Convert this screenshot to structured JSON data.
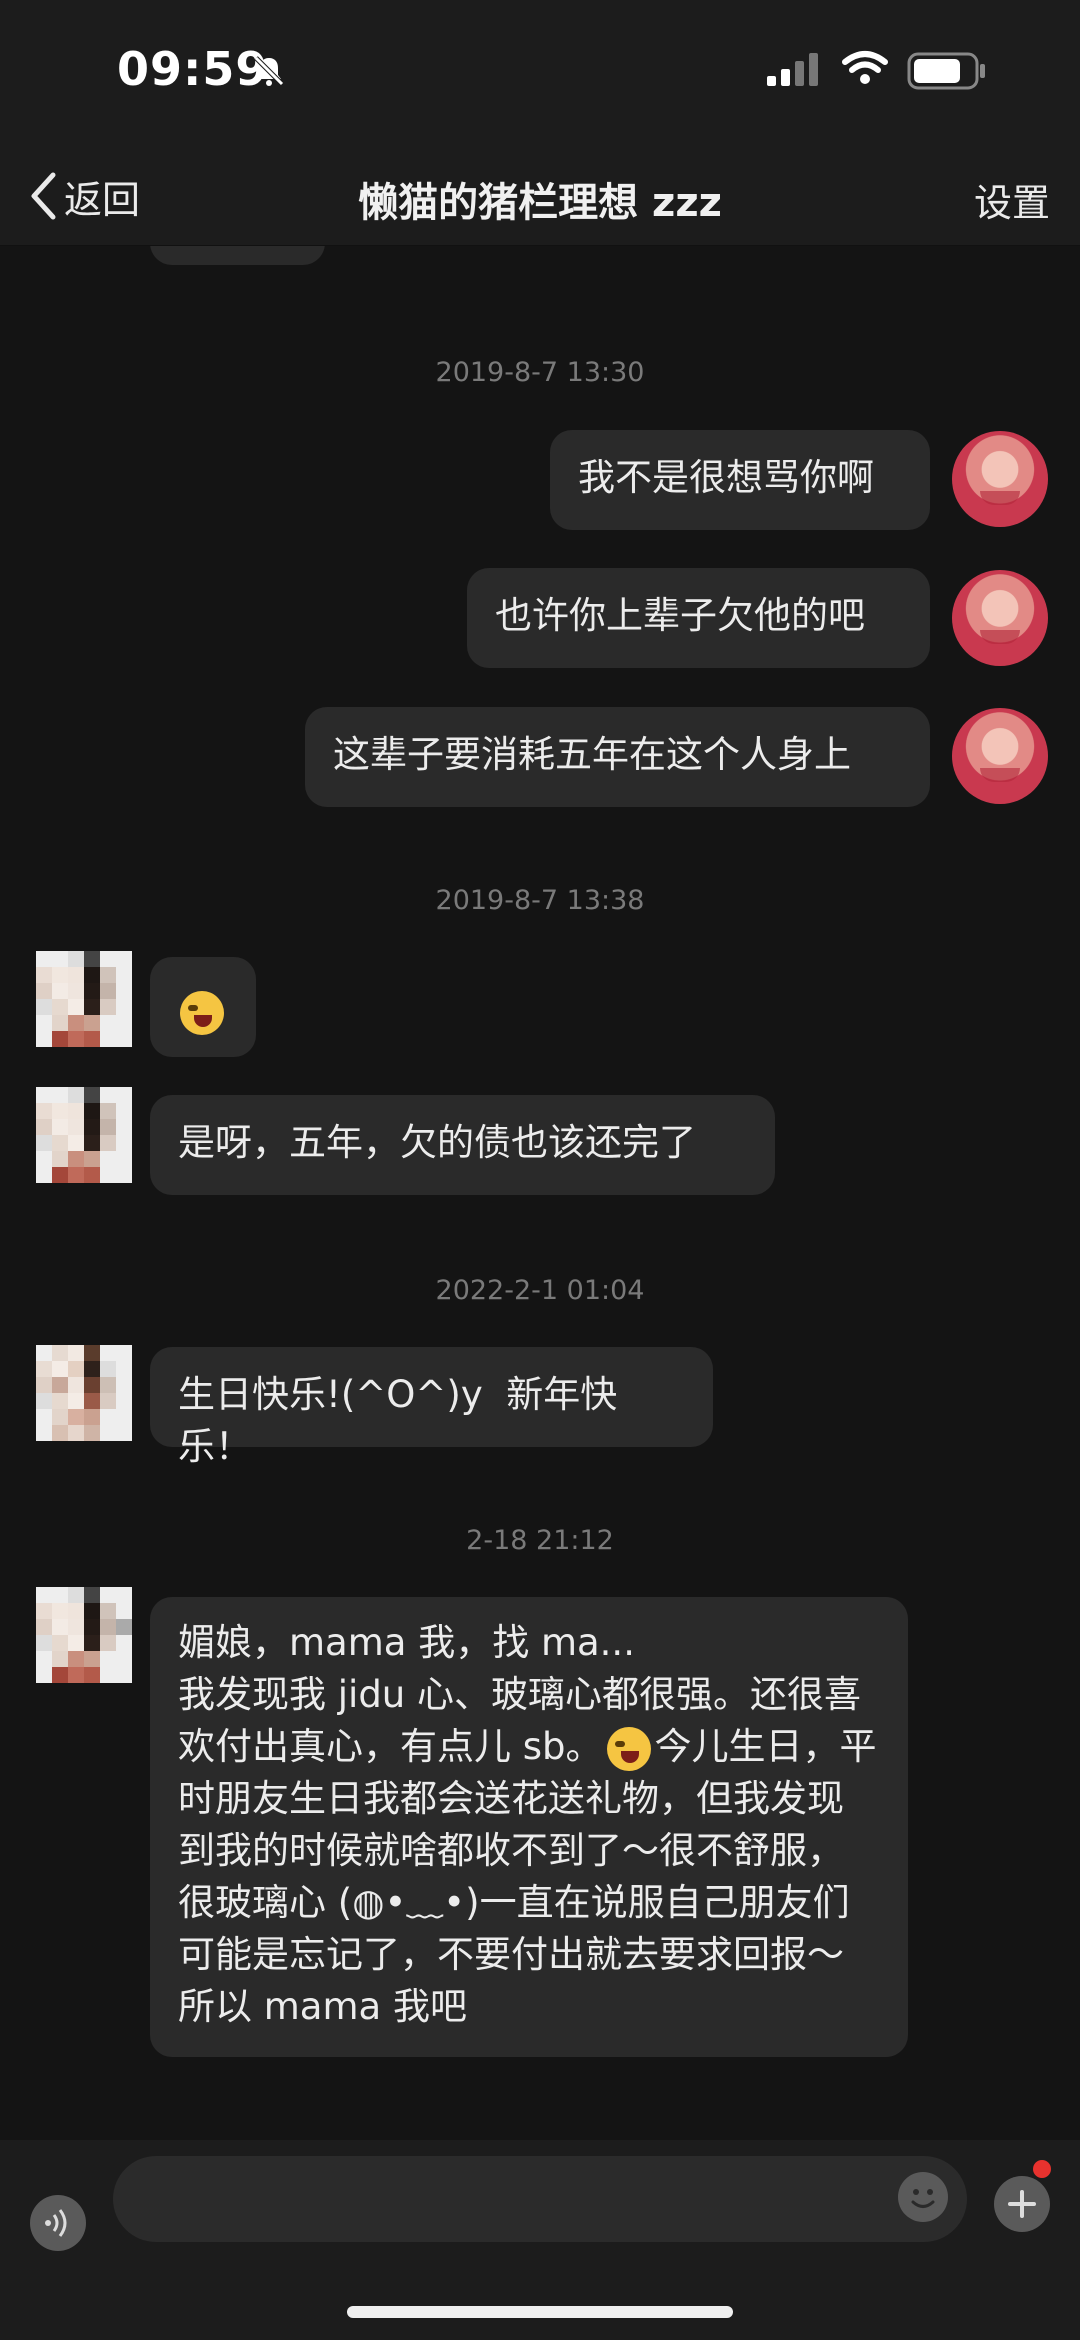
{
  "status_bar": {
    "time": "09:59"
  },
  "nav": {
    "back_label": "返回",
    "title": "懒猫的猪栏理想 zzz",
    "settings_label": "设置"
  },
  "messages": {
    "t1": "2019-8-7 13:30",
    "m1": "我不是很想骂你啊",
    "m2": "也许你上辈子欠他的吧",
    "m3": "这辈子要消耗五年在这个人身上",
    "t2": "2019-8-7 13:38",
    "m5": "是呀，五年，欠的债也该还完了",
    "t3": "2022-2-1 01:04",
    "m6": "生日快乐!(^O^)y  新年快乐！",
    "t4": "2-18 21:12",
    "m7a": "媚娘，mama 我，找 ma...\n我发现我 jidu 心、玻璃心都很强。还很喜欢付出真心，有点儿 sb。",
    "m7b": "今儿生日，平时朋友生日我都会送花送礼物，但我发现到我的时候就啥都收不到了～很不舒服，很玻璃心 (◍•﹏•)一直在说服自己朋友们可能是忘记了，不要付出就去要求回报～所以 mama 我吧"
  },
  "icons": {
    "back": "chevron-left-icon",
    "voice": "voice-icon",
    "emoji": "smile-icon",
    "plus": "plus-icon",
    "emoji_in_message": "laughing-crying-emoji"
  },
  "colors": {
    "bubble": "#2a2a2a",
    "background": "#141414",
    "badge": "#e8322e"
  }
}
